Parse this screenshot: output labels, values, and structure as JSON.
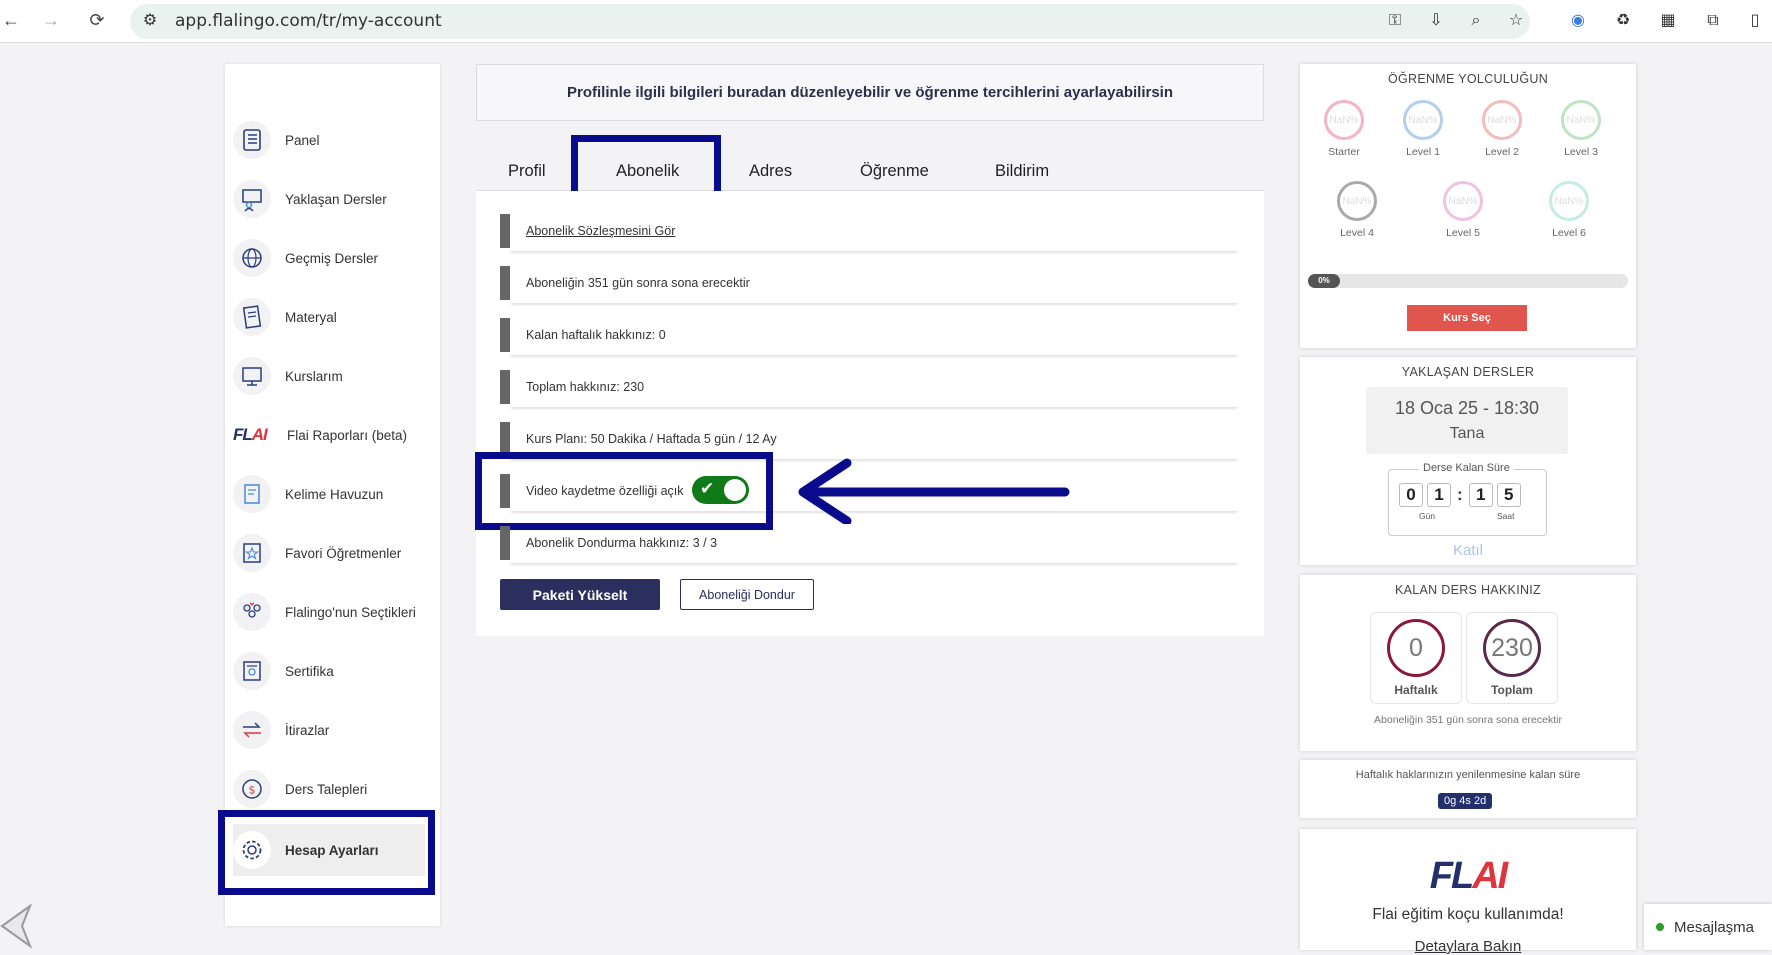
{
  "browser": {
    "url": "app.flalingo.com/tr/my-account"
  },
  "sidebar": {
    "items": [
      {
        "label": "Panel",
        "icon": "list-icon"
      },
      {
        "label": "Yaklaşan Dersler",
        "icon": "teacher-board-icon"
      },
      {
        "label": "Geçmiş Dersler",
        "icon": "globe-icon"
      },
      {
        "label": "Materyal",
        "icon": "document-icon"
      },
      {
        "label": "Kurslarım",
        "icon": "monitor-icon"
      },
      {
        "label": "Flai Raporları (beta)",
        "icon": "flai-logo-icon"
      },
      {
        "label": "Kelime Havuzun",
        "icon": "notebook-icon"
      },
      {
        "label": "Favori Öğretmenler",
        "icon": "star-icon"
      },
      {
        "label": "Flalingo'nun Seçtikleri",
        "icon": "people-icon"
      },
      {
        "label": "Sertifika",
        "icon": "certificate-icon"
      },
      {
        "label": "İtirazlar",
        "icon": "exchange-icon"
      },
      {
        "label": "Ders Talepleri",
        "icon": "money-icon"
      },
      {
        "label": "Hesap Ayarları",
        "icon": "gear-icon"
      }
    ]
  },
  "main": {
    "info": "Profilinle ilgili bilgileri buradan düzenleyebilir ve öğrenme tercihlerini ayarlayabilirsin",
    "tabs": [
      "Profil",
      "Abonelik",
      "Adres",
      "Öğrenme",
      "Bildirim"
    ],
    "active_tab": "Abonelik",
    "rows": [
      {
        "text": "Abonelik Sözleşmesini Gör"
      },
      {
        "text": "Aboneliğin 351 gün sonra sona erecektir"
      },
      {
        "label": "Kalan haftalık hakkınız:",
        "value": "0"
      },
      {
        "label": "Toplam hakkınız:",
        "value": "230"
      },
      {
        "label": "Kurs Planı:",
        "value": "50 Dakika / Haftada 5 gün / 12 Ay"
      },
      {
        "text": "Video kaydetme özelliği açık"
      },
      {
        "text": "Abonelik Dondurma hakkınız: 3 / 3"
      }
    ],
    "video_toggle_on": true,
    "upgrade_button": "Paketi Yükselt",
    "freeze_button": "Aboneliği Dondur"
  },
  "right": {
    "journey": {
      "title": "ÖĞRENME YOLCULUĞUN",
      "levels": [
        {
          "label": "Starter",
          "value": "NaN%",
          "color": "#f4b4c4"
        },
        {
          "label": "Level 1",
          "value": "NaN%",
          "color": "#b4cfee"
        },
        {
          "label": "Level 2",
          "value": "NaN%",
          "color": "#f4bcbc"
        },
        {
          "label": "Level 3",
          "value": "NaN%",
          "color": "#bfe3c4"
        },
        {
          "label": "Level 4",
          "value": "NaN%",
          "color": "#aaaaaa"
        },
        {
          "label": "Level 5",
          "value": "NaN%",
          "color": "#ecc4e0"
        },
        {
          "label": "Level 6",
          "value": "NaN%",
          "color": "#c4ece4"
        }
      ],
      "progress": "0%",
      "button": "Kurs Seç"
    },
    "upcoming": {
      "title": "YAKLAŞAN DERSLER",
      "datetime": "18 Oca 25 - 18:30",
      "teacher": "Tana",
      "remaining_label": "Derse Kalan Süre",
      "days": [
        "0",
        "1"
      ],
      "hours": [
        "1",
        "5"
      ],
      "days_label": "Gün",
      "hours_label": "Saat",
      "join": "Katıl"
    },
    "remaining": {
      "title": "KALAN DERS HAKKINIZ",
      "weekly": "0",
      "weekly_label": "Haftalık",
      "total": "230",
      "total_label": "Toplam",
      "note": "Aboneliğin 351 gün sonra sona erecektir"
    },
    "renewal": {
      "text": "Haftalık haklarınızın yenilenmesine kalan süre",
      "badge": "0g 4s 2d"
    },
    "flai": {
      "logo": "FLAI",
      "text": "Flai eğitim koçu kullanımda!",
      "link": "Detaylara Bakın"
    }
  },
  "messaging": {
    "label": "Mesajlaşma"
  }
}
